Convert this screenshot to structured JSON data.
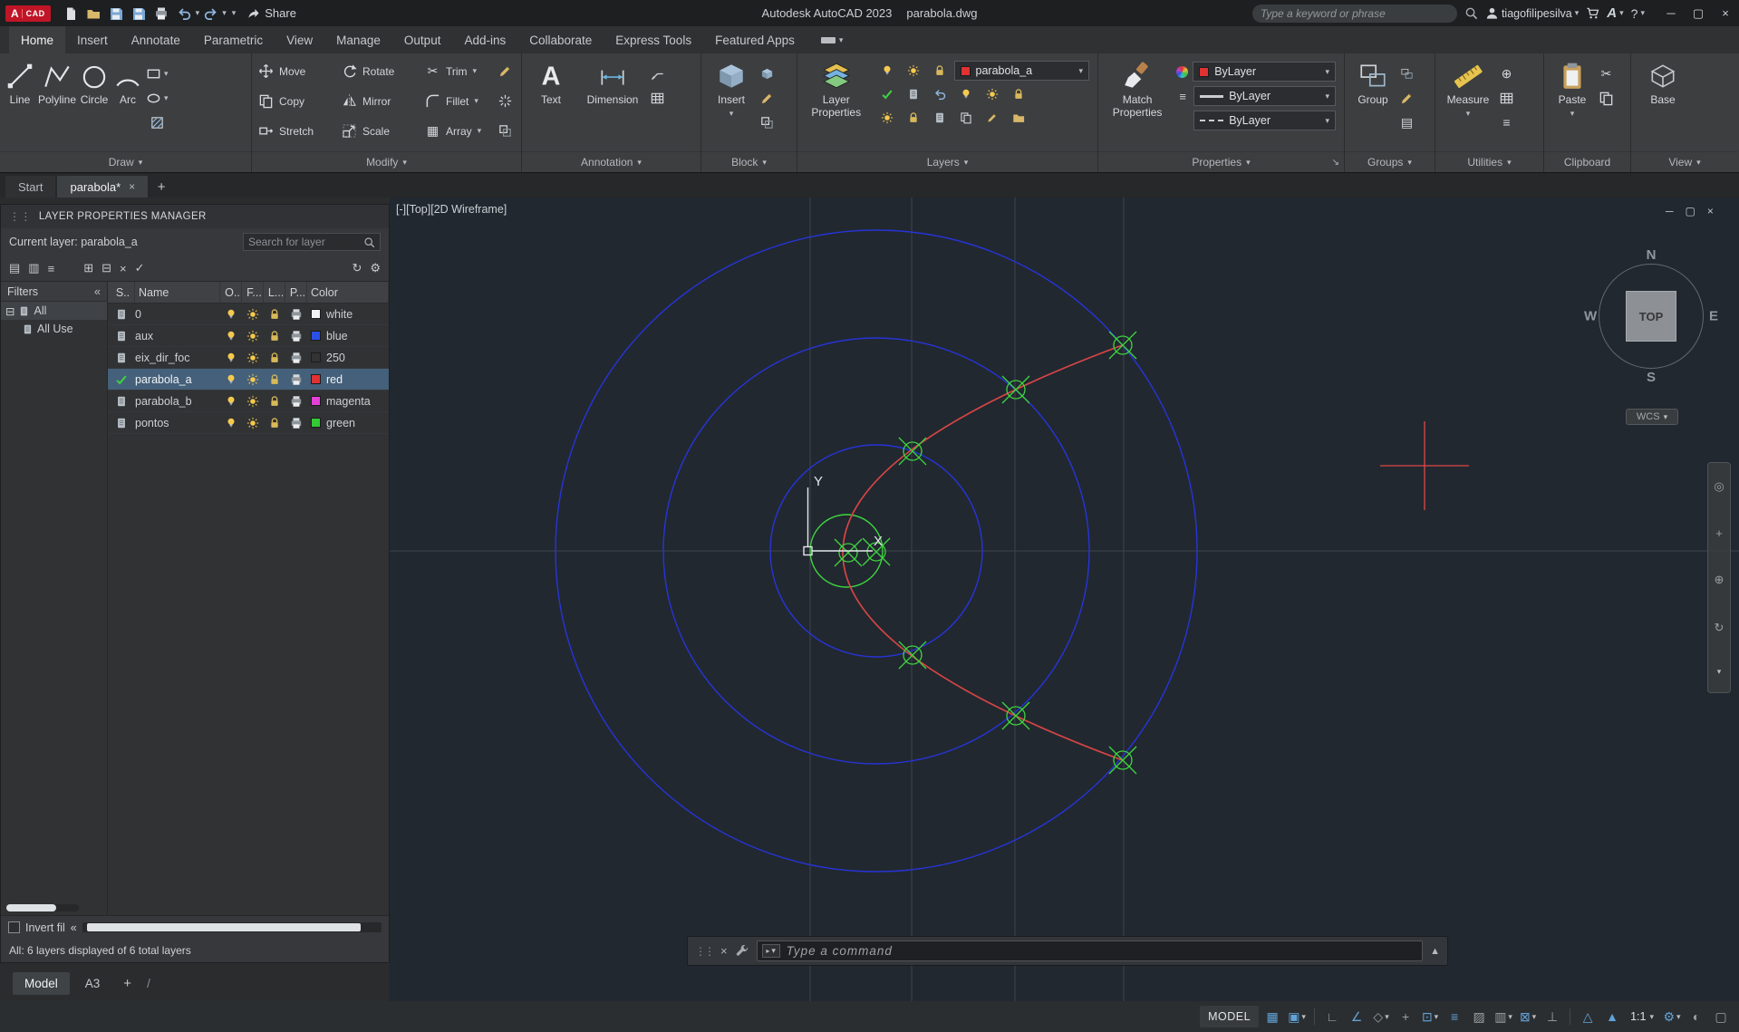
{
  "titlebar": {
    "logo": "A",
    "logo_text": "CAD",
    "share": "Share",
    "app_title": "Autodesk AutoCAD 2023",
    "doc_name": "parabola.dwg",
    "search_placeholder": "Type a keyword or phrase",
    "username": "tiagofilipesilva",
    "autodesk_a": "A",
    "help": "?"
  },
  "ribbon": {
    "tabs": [
      "Home",
      "Insert",
      "Annotate",
      "Parametric",
      "View",
      "Manage",
      "Output",
      "Add-ins",
      "Collaborate",
      "Express Tools",
      "Featured Apps"
    ],
    "draw": {
      "label": "Draw",
      "line": "Line",
      "polyline": "Polyline",
      "circle": "Circle",
      "arc": "Arc"
    },
    "modify": {
      "label": "Modify",
      "move": "Move",
      "rotate": "Rotate",
      "trim": "Trim",
      "copy": "Copy",
      "mirror": "Mirror",
      "fillet": "Fillet",
      "stretch": "Stretch",
      "scale": "Scale",
      "array": "Array"
    },
    "annotation": {
      "label": "Annotation",
      "text": "Text",
      "dimension": "Dimension"
    },
    "block": {
      "label": "Block",
      "insert": "Insert"
    },
    "layers": {
      "label": "Layers",
      "layer_properties": "Layer Properties",
      "current_layer": "parabola_a",
      "swatch": "#e03232"
    },
    "properties": {
      "label": "Properties",
      "match_properties": "Match Properties",
      "color": "ByLayer",
      "lineweight": "ByLayer",
      "linetype": "ByLayer",
      "color_swatch": "#e03232"
    },
    "groups": {
      "label": "Groups",
      "group": "Group"
    },
    "utilities": {
      "label": "Utilities",
      "measure": "Measure"
    },
    "clipboard": {
      "label": "Clipboard",
      "paste": "Paste"
    },
    "view": {
      "label": "View",
      "base": "Base"
    }
  },
  "file_tabs": {
    "start": "Start",
    "doc": "parabola*"
  },
  "palette": {
    "title": "LAYER PROPERTIES MANAGER",
    "current_layer": "Current layer: parabola_a",
    "search_placeholder": "Search for layer",
    "filters_label": "Filters",
    "tree_all": "All",
    "tree_all_used": "All Use",
    "columns": {
      "status": "S..",
      "name": "Name",
      "on": "O..",
      "freeze": "F...",
      "lock": "L...",
      "plot": "P...",
      "color": "Color"
    },
    "rows": [
      {
        "name": "0",
        "color": "white",
        "swatch": "#f0f2f4"
      },
      {
        "name": "aux",
        "color": "blue",
        "swatch": "#2b50e8"
      },
      {
        "name": "eix_dir_foc",
        "color": "250",
        "swatch": "#333333"
      },
      {
        "name": "parabola_a",
        "color": "red",
        "swatch": "#e03232"
      },
      {
        "name": "parabola_b",
        "color": "magenta",
        "swatch": "#e241d6"
      },
      {
        "name": "pontos",
        "color": "green",
        "swatch": "#33cc33"
      }
    ],
    "invert_filter": "Invert fil",
    "status_text": "All: 6 layers displayed of 6 total layers"
  },
  "viewport": {
    "controls": "[-]",
    "view_name": "[Top]",
    "visual_style": "[2D Wireframe]",
    "viewcube": {
      "n": "N",
      "e": "E",
      "s": "S",
      "w": "W",
      "face": "TOP"
    },
    "wcs": "WCS",
    "ucs_x": "X",
    "ucs_y": "Y"
  },
  "drawing": {
    "background": "#212830",
    "construction_color": "#3e444c",
    "circle_color": "#2734d8",
    "parabola_color": "#d64545",
    "point_color": "#3fd43f",
    "ucs_color": "#e4e7ea",
    "crosshair_color": "#e04848"
  },
  "command_line": {
    "placeholder": "Type a command"
  },
  "layout_tabs": {
    "model": "Model",
    "a3": "A3",
    "add": "+"
  },
  "statusbar": {
    "model": "MODEL",
    "scale": "1:1"
  },
  "icons": {
    "caret_down": "▾",
    "caret_up": "▲",
    "win_min": "─",
    "win_max": "▢",
    "win_close": "×",
    "tab_close": "×",
    "plus": "+",
    "collapse_left": "«",
    "expander": "⊟",
    "slash": "/",
    "grip": "⋮⋮",
    "grid": "▦",
    "snap": "▣",
    "ortho": "∟",
    "polar": "∠",
    "isodraft": "◇",
    "otrack": "+",
    "osnap": "⊡",
    "lineweight": "≡",
    "transparency": "▨",
    "cycling": "▥",
    "osnap3d": "⊠",
    "ducs": "⊥",
    "annotation_visibility": "△",
    "autoscale": "▲",
    "gear": "⚙",
    "isolate": "◐",
    "clean_screen": "▢",
    "trim": "✂",
    "array": "▦",
    "refresh": "↻",
    "check": "✓",
    "text_tool": "A",
    "filter_prop": "▤",
    "filter_group": "▥",
    "layer_states": "≡",
    "new_layer": "⊞",
    "new_vp_layer": "⊟",
    "delete_layer": "×",
    "set_current": "✓",
    "table": "▦",
    "list": "≡",
    "idpoint": "⊕",
    "launcher": "↘"
  }
}
